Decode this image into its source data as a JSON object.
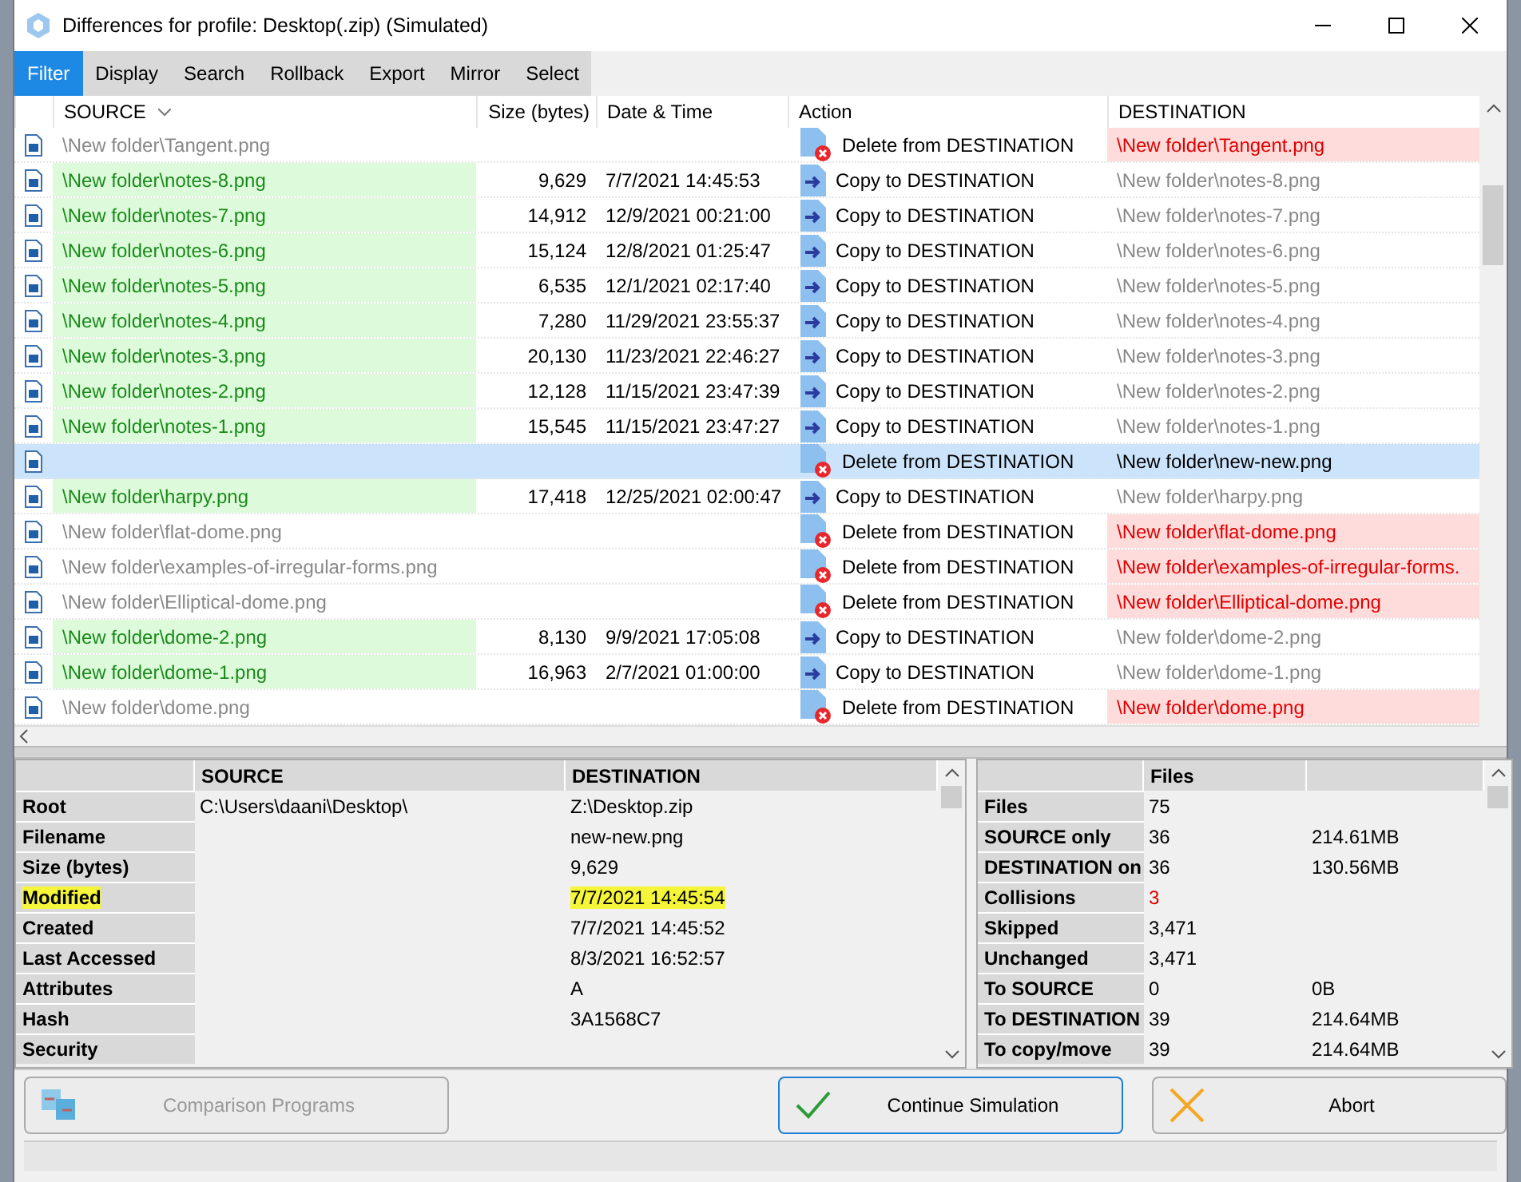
{
  "window": {
    "title": "Differences for profile: Desktop(.zip) (Simulated)"
  },
  "menu": [
    {
      "label": "Filter",
      "selected": true
    },
    {
      "label": "Display",
      "selected": false
    },
    {
      "label": "Search",
      "selected": false
    },
    {
      "label": "Rollback",
      "selected": false
    },
    {
      "label": "Export",
      "selected": false
    },
    {
      "label": "Mirror",
      "selected": false
    },
    {
      "label": "Select",
      "selected": false
    }
  ],
  "table": {
    "columns": [
      "SOURCE",
      "Size (bytes)",
      "Date & Time",
      "Action",
      "DESTINATION"
    ],
    "rows": [
      {
        "kind": "delete",
        "source": "\\New folder\\Tangent.png",
        "size": "",
        "date": "",
        "action_label": "Delete from DESTINATION",
        "destination": "\\New folder\\Tangent.png",
        "selected": false
      },
      {
        "kind": "copy",
        "source": "\\New folder\\notes-8.png",
        "size": "9,629",
        "date": "7/7/2021 14:45:53",
        "action_label": "Copy to DESTINATION",
        "destination": "\\New folder\\notes-8.png",
        "selected": false
      },
      {
        "kind": "copy",
        "source": "\\New folder\\notes-7.png",
        "size": "14,912",
        "date": "12/9/2021 00:21:00",
        "action_label": "Copy to DESTINATION",
        "destination": "\\New folder\\notes-7.png",
        "selected": false
      },
      {
        "kind": "copy",
        "source": "\\New folder\\notes-6.png",
        "size": "15,124",
        "date": "12/8/2021 01:25:47",
        "action_label": "Copy to DESTINATION",
        "destination": "\\New folder\\notes-6.png",
        "selected": false
      },
      {
        "kind": "copy",
        "source": "\\New folder\\notes-5.png",
        "size": "6,535",
        "date": "12/1/2021 02:17:40",
        "action_label": "Copy to DESTINATION",
        "destination": "\\New folder\\notes-5.png",
        "selected": false
      },
      {
        "kind": "copy",
        "source": "\\New folder\\notes-4.png",
        "size": "7,280",
        "date": "11/29/2021 23:55:37",
        "action_label": "Copy to DESTINATION",
        "destination": "\\New folder\\notes-4.png",
        "selected": false
      },
      {
        "kind": "copy",
        "source": "\\New folder\\notes-3.png",
        "size": "20,130",
        "date": "11/23/2021 22:46:27",
        "action_label": "Copy to DESTINATION",
        "destination": "\\New folder\\notes-3.png",
        "selected": false
      },
      {
        "kind": "copy",
        "source": "\\New folder\\notes-2.png",
        "size": "12,128",
        "date": "11/15/2021 23:47:39",
        "action_label": "Copy to DESTINATION",
        "destination": "\\New folder\\notes-2.png",
        "selected": false
      },
      {
        "kind": "copy",
        "source": "\\New folder\\notes-1.png",
        "size": "15,545",
        "date": "11/15/2021 23:47:27",
        "action_label": "Copy to DESTINATION",
        "destination": "\\New folder\\notes-1.png",
        "selected": false
      },
      {
        "kind": "delete",
        "source": "",
        "size": "",
        "date": "",
        "action_label": "Delete from DESTINATION",
        "destination": "\\New folder\\new-new.png",
        "selected": true
      },
      {
        "kind": "copy",
        "source": "\\New folder\\harpy.png",
        "size": "17,418",
        "date": "12/25/2021 02:00:47",
        "action_label": "Copy to DESTINATION",
        "destination": "\\New folder\\harpy.png",
        "selected": false
      },
      {
        "kind": "delete",
        "source": "\\New folder\\flat-dome.png",
        "size": "",
        "date": "",
        "action_label": "Delete from DESTINATION",
        "destination": "\\New folder\\flat-dome.png",
        "selected": false
      },
      {
        "kind": "delete",
        "source": "\\New folder\\examples-of-irregular-forms.png",
        "size": "",
        "date": "",
        "action_label": "Delete from DESTINATION",
        "destination": "\\New folder\\examples-of-irregular-forms.",
        "selected": false
      },
      {
        "kind": "delete",
        "source": "\\New folder\\Elliptical-dome.png",
        "size": "",
        "date": "",
        "action_label": "Delete from DESTINATION",
        "destination": "\\New folder\\Elliptical-dome.png",
        "selected": false
      },
      {
        "kind": "copy",
        "source": "\\New folder\\dome-2.png",
        "size": "8,130",
        "date": "9/9/2021 17:05:08",
        "action_label": "Copy to DESTINATION",
        "destination": "\\New folder\\dome-2.png",
        "selected": false
      },
      {
        "kind": "copy",
        "source": "\\New folder\\dome-1.png",
        "size": "16,963",
        "date": "2/7/2021 01:00:00",
        "action_label": "Copy to DESTINATION",
        "destination": "\\New folder\\dome-1.png",
        "selected": false
      },
      {
        "kind": "delete",
        "source": "\\New folder\\dome.png",
        "size": "",
        "date": "",
        "action_label": "Delete from DESTINATION",
        "destination": "\\New folder\\dome.png",
        "selected": false
      }
    ]
  },
  "details": {
    "columns": [
      "SOURCE",
      "DESTINATION"
    ],
    "rows": [
      {
        "label": "Root",
        "source": "C:\\Users\\daani\\Desktop\\",
        "destination": "Z:\\Desktop.zip",
        "highlighted": false
      },
      {
        "label": "Filename",
        "source": "",
        "destination": "new-new.png",
        "highlighted": false
      },
      {
        "label": "Size (bytes)",
        "source": "",
        "destination": "9,629",
        "highlighted": false
      },
      {
        "label": "Modified",
        "source": "",
        "destination": "7/7/2021 14:45:54",
        "highlighted": true
      },
      {
        "label": "Created",
        "source": "",
        "destination": "7/7/2021 14:45:52",
        "highlighted": false
      },
      {
        "label": "Last Accessed",
        "source": "",
        "destination": "8/3/2021 16:52:57",
        "highlighted": false
      },
      {
        "label": "Attributes",
        "source": "",
        "destination": "A",
        "highlighted": false
      },
      {
        "label": "Hash",
        "source": "",
        "destination": "3A1568C7",
        "highlighted": false
      },
      {
        "label": "Security",
        "source": "",
        "destination": "",
        "highlighted": false
      }
    ]
  },
  "stats": {
    "header": "Files",
    "rows": [
      {
        "label": "Files",
        "files": "75",
        "size": "",
        "alert": false
      },
      {
        "label": "SOURCE only",
        "files": "36",
        "size": "214.61MB",
        "alert": false
      },
      {
        "label": "DESTINATION on",
        "files": "36",
        "size": "130.56MB",
        "alert": false
      },
      {
        "label": "Collisions",
        "files": "3",
        "size": "",
        "alert": true
      },
      {
        "label": "Skipped",
        "files": "3,471",
        "size": "",
        "alert": false
      },
      {
        "label": "Unchanged",
        "files": "3,471",
        "size": "",
        "alert": false
      },
      {
        "label": "To SOURCE",
        "files": "0",
        "size": "0B",
        "alert": false
      },
      {
        "label": "To DESTINATION",
        "files": "39",
        "size": "214.64MB",
        "alert": false
      },
      {
        "label": "To copy/move",
        "files": "39",
        "size": "214.64MB",
        "alert": false
      }
    ]
  },
  "buttons": [
    {
      "label": "Comparison Programs",
      "kind": "compare",
      "disabled": true,
      "default": false
    },
    {
      "label": "Continue Simulation",
      "kind": "continue",
      "disabled": false,
      "default": true
    },
    {
      "label": "Abort",
      "kind": "abort",
      "disabled": false,
      "default": false
    }
  ]
}
